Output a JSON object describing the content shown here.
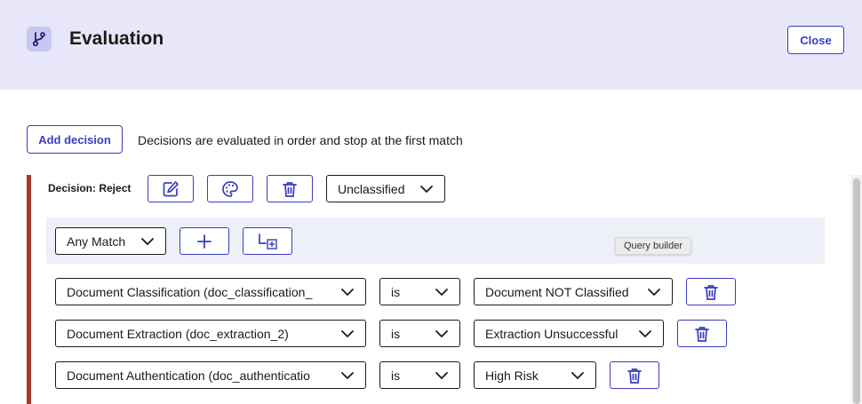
{
  "header": {
    "title": "Evaluation",
    "close_label": "Close"
  },
  "toolbar": {
    "add_decision_label": "Add decision",
    "helper_text": "Decisions are evaluated in order and stop at the first match"
  },
  "decision": {
    "label": "Decision: Reject",
    "status_select": "Unclassified",
    "match_select": "Any Match",
    "tooltip": "Query builder",
    "accent_color": "#a33a2f",
    "rules": [
      {
        "field": "Document Classification (doc_classification_",
        "operator": "is",
        "value": "Document NOT Classified"
      },
      {
        "field": "Document Extraction (doc_extraction_2)",
        "operator": "is",
        "value": "Extraction Unsuccessful"
      },
      {
        "field": "Document Authentication (doc_authenticatio",
        "operator": "is",
        "value": "High Risk"
      }
    ]
  },
  "colors": {
    "primary": "#3a3dbe",
    "header_bg": "#e8e7f9",
    "group_bg": "#eef0f8"
  },
  "icons": [
    "branch-icon",
    "edit-icon",
    "palette-icon",
    "trash-icon",
    "chevron-down-icon",
    "plus-icon",
    "add-group-icon"
  ]
}
